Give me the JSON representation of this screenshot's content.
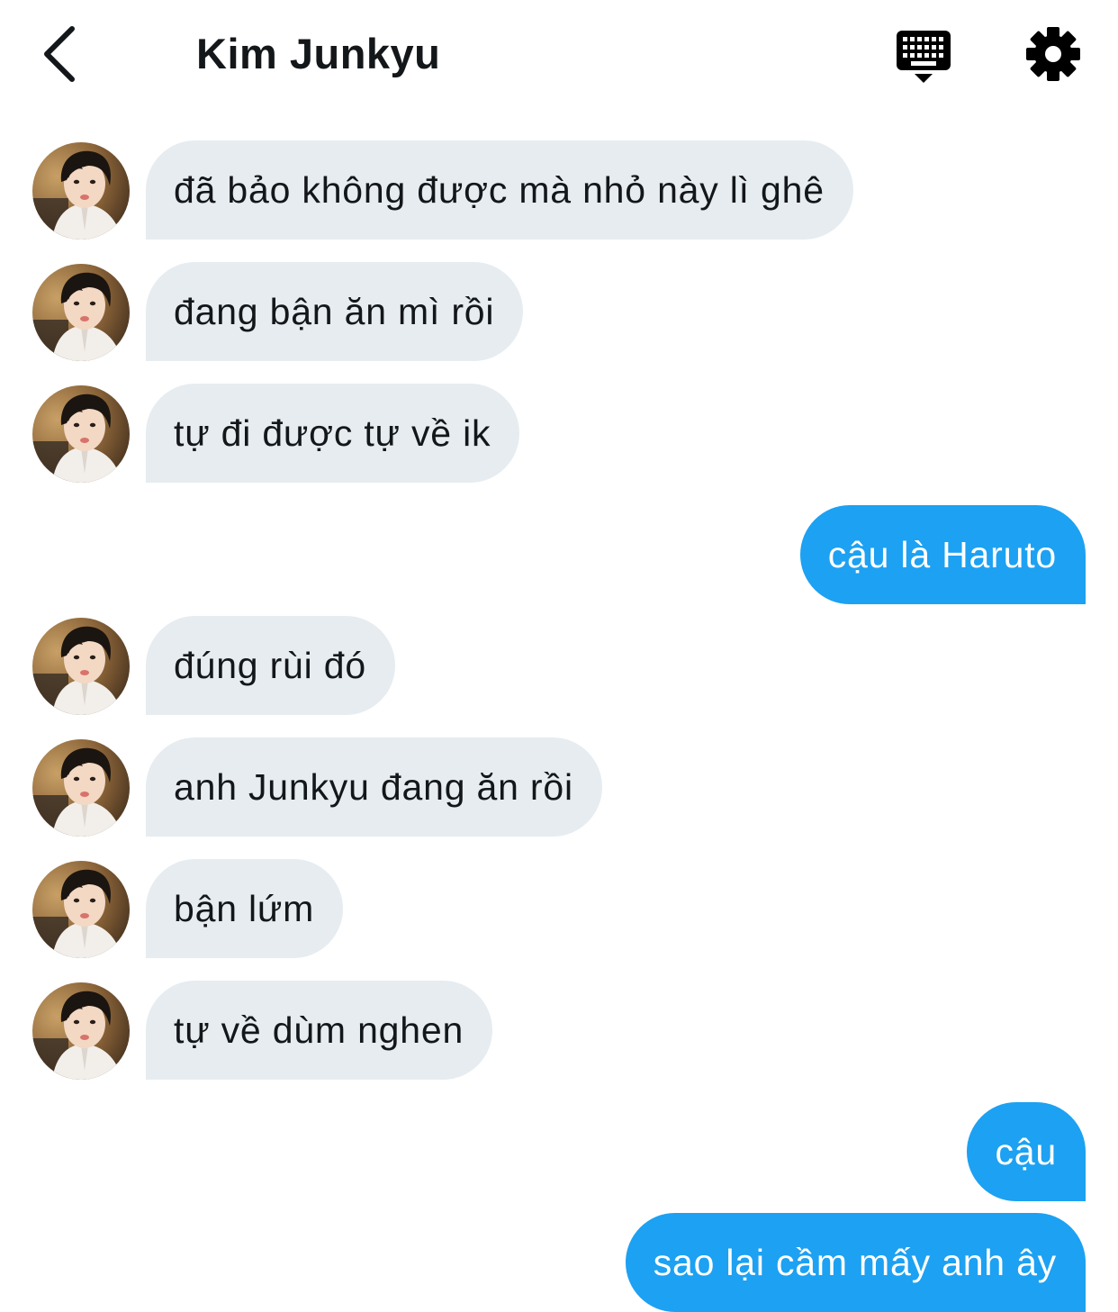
{
  "header": {
    "title": "Kim Junkyu",
    "back_icon": "chevron-left-icon",
    "keyboard_icon": "keyboard-icon",
    "settings_icon": "gear-icon"
  },
  "colors": {
    "incoming_bubble": "#e6ecf0",
    "outgoing_bubble": "#1da1f2",
    "text": "#14171a"
  },
  "messages": [
    {
      "sender": "Kim Junkyu",
      "direction": "incoming",
      "text": "đã bảo không được mà nhỏ này lì ghê"
    },
    {
      "sender": "Kim Junkyu",
      "direction": "incoming",
      "text": "đang bận ăn mì rồi"
    },
    {
      "sender": "Kim Junkyu",
      "direction": "incoming",
      "text": "tự đi được tự về ik"
    },
    {
      "sender": "me",
      "direction": "outgoing",
      "text": "cậu là Haruto"
    },
    {
      "sender": "Kim Junkyu",
      "direction": "incoming",
      "text": "đúng rùi đó"
    },
    {
      "sender": "Kim Junkyu",
      "direction": "incoming",
      "text": "anh Junkyu đang ăn rồi"
    },
    {
      "sender": "Kim Junkyu",
      "direction": "incoming",
      "text": "bận lứm"
    },
    {
      "sender": "Kim Junkyu",
      "direction": "incoming",
      "text": "tự về dùm nghen"
    },
    {
      "sender": "me",
      "direction": "outgoing",
      "text": "cậu"
    },
    {
      "sender": "me",
      "direction": "outgoing",
      "text": "sao lại cầm mấy anh ây"
    }
  ]
}
